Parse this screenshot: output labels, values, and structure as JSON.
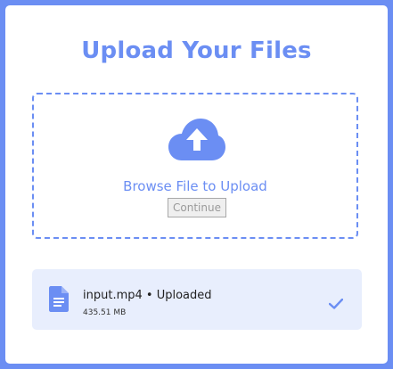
{
  "title": "Upload Your Files",
  "dropzone": {
    "browse_label": "Browse File to Upload",
    "continue_label": "Continue",
    "upload_icon": "cloud-upload-icon"
  },
  "file": {
    "name_status": "input.mp4 • Uploaded",
    "size": "435.51 MB",
    "file_icon": "document-icon",
    "status_icon": "check-icon"
  },
  "colors": {
    "accent": "#6b8ef3",
    "file_row_bg": "#e8eefd",
    "background": "#ffffff"
  }
}
